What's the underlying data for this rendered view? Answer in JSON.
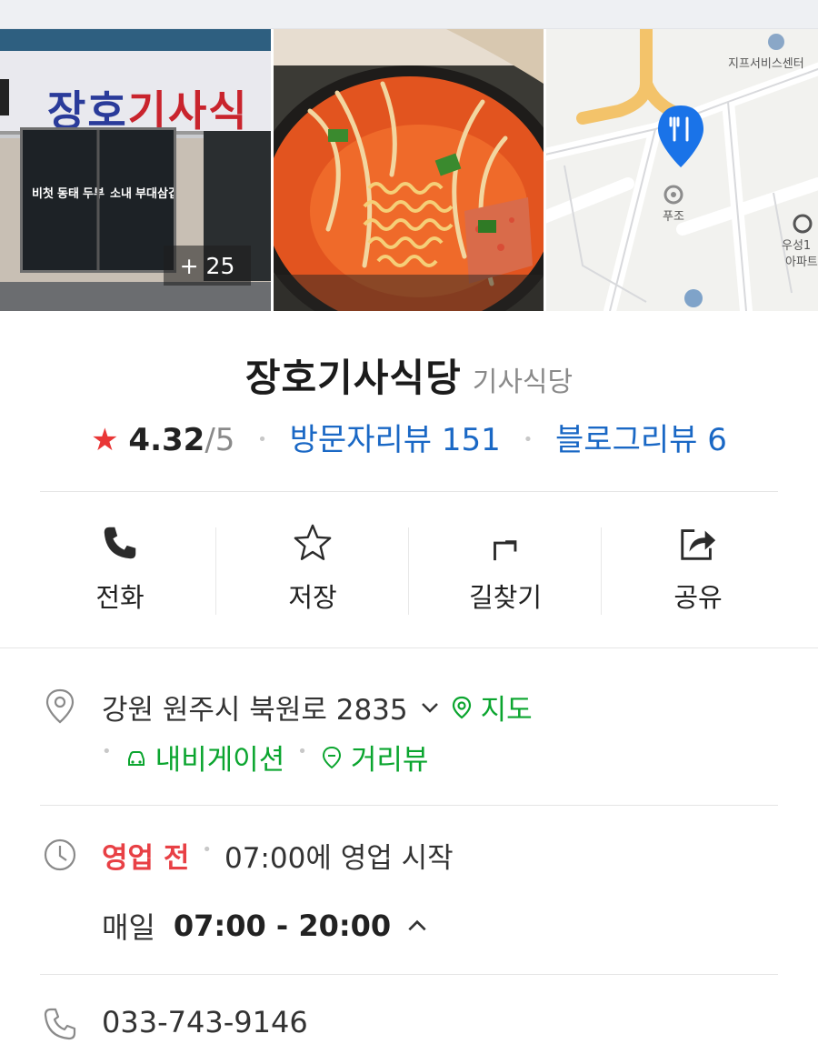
{
  "photos": {
    "storefront_sign": [
      "장호",
      "기사식"
    ],
    "storefront_menu_columns": [
      "비첫",
      "동태",
      "두부",
      "소내",
      "부대",
      "삼겹"
    ],
    "more_count": "+ 25"
  },
  "map": {
    "labels": [
      "지프서비스센터",
      "푸조",
      "우성1",
      "아파트"
    ]
  },
  "place": {
    "name": "장호기사식당",
    "category": "기사식당",
    "rating": "4.32",
    "rating_total": "/5",
    "visitor_reviews": "방문자리뷰 151",
    "blog_reviews": "블로그리뷰 6"
  },
  "actions": [
    {
      "label": "전화",
      "icon": "phone-icon"
    },
    {
      "label": "저장",
      "icon": "star-outline-icon"
    },
    {
      "label": "길찾기",
      "icon": "directions-icon"
    },
    {
      "label": "공유",
      "icon": "share-icon"
    }
  ],
  "address": {
    "text": "강원 원주시 북원로 2835",
    "map_link": "지도",
    "navigation_link": "내비게이션",
    "street_view_link": "거리뷰"
  },
  "hours": {
    "status": "영업 전",
    "status_detail": "07:00에 영업 시작",
    "day": "매일",
    "time": "07:00 - 20:00"
  },
  "phone": "033-743-9146",
  "colors": {
    "accent_blue": "#1a68c5",
    "accent_green": "#0ba52f",
    "status_red": "#e84045",
    "star_red": "#e93636"
  }
}
